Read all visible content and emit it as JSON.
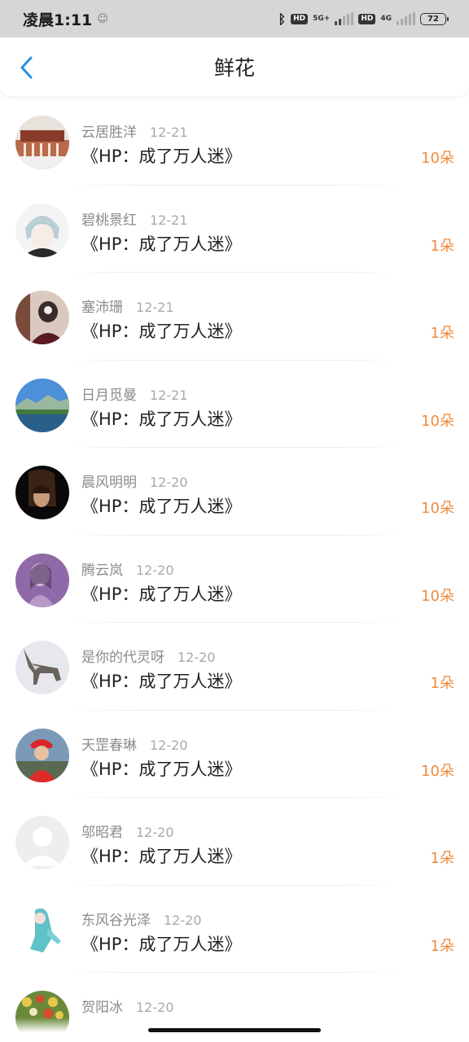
{
  "status_bar": {
    "time": "凌晨1:11",
    "network_1": "5G+",
    "network_2": "4G",
    "hd": "HD",
    "battery": "72"
  },
  "header": {
    "title": "鲜花",
    "back_icon": "chevron-left-icon"
  },
  "colors": {
    "accent": "#2a8fe0",
    "count": "#f08a3c"
  },
  "rows": [
    {
      "name": "云居胜洋",
      "date": "12-21",
      "book": "《HP：成了万人迷》",
      "count": "10朵"
    },
    {
      "name": "碧桃景红",
      "date": "12-21",
      "book": "《HP：成了万人迷》",
      "count": "1朵"
    },
    {
      "name": "塞沛珊",
      "date": "12-21",
      "book": "《HP：成了万人迷》",
      "count": "1朵"
    },
    {
      "name": "日月觅曼",
      "date": "12-21",
      "book": "《HP：成了万人迷》",
      "count": "10朵"
    },
    {
      "name": "晨风明明",
      "date": "12-20",
      "book": "《HP：成了万人迷》",
      "count": "10朵"
    },
    {
      "name": "腾云岚",
      "date": "12-20",
      "book": "《HP：成了万人迷》",
      "count": "10朵"
    },
    {
      "name": "是你的代灵呀",
      "date": "12-20",
      "book": "《HP：成了万人迷》",
      "count": "1朵"
    },
    {
      "name": "天罡春琳",
      "date": "12-20",
      "book": "《HP：成了万人迷》",
      "count": "10朵"
    },
    {
      "name": "邬昭君",
      "date": "12-20",
      "book": "《HP：成了万人迷》",
      "count": "1朵"
    },
    {
      "name": "东风谷光泽",
      "date": "12-20",
      "book": "《HP：成了万人迷》",
      "count": "1朵"
    },
    {
      "name": "贺阳冰",
      "date": "12-20",
      "book": "",
      "count": ""
    }
  ]
}
